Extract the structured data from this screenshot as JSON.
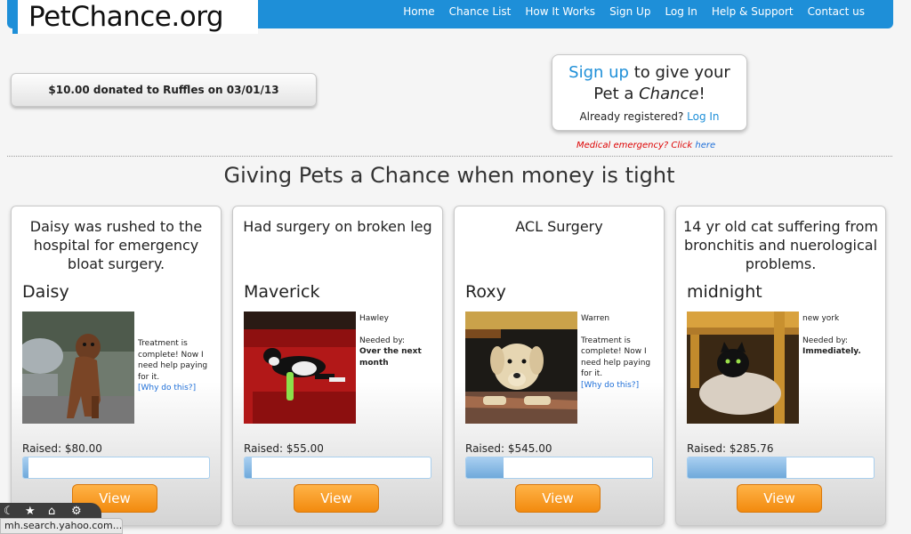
{
  "header": {
    "logo": "PetChance.org",
    "nav": [
      "Home",
      "Chance List",
      "How It Works",
      "Sign Up",
      "Log In",
      "Help & Support",
      "Contact us"
    ]
  },
  "donation": "$10.00 donated to Ruffles on 03/01/13",
  "signup": {
    "signup_link": "Sign up",
    "line1_rest": " to give your",
    "line2_pre": "Pet a ",
    "line2_em": "Chance",
    "line2_post": "!",
    "registered": "Already registered? ",
    "login_link": "Log In"
  },
  "emergency": {
    "text": "Medical emergency? Click ",
    "link": "here"
  },
  "tagline": "Giving Pets a Chance when money is tight",
  "cards": [
    {
      "title": "Daisy was rushed to the hospital for emergency bloat surgery.",
      "name": "Daisy",
      "location": "",
      "needed_label": "",
      "needed_value": "",
      "note": "Treatment is complete! Now I need help paying for it.",
      "why": "[Why do this?]",
      "raised": "Raised: $80.00",
      "progress": 0.03,
      "view": "View"
    },
    {
      "title": "Had surgery on broken leg",
      "name": "Maverick",
      "location": "Hawley",
      "needed_label": "Needed by:",
      "needed_value": "Over the next month",
      "note": "",
      "why": "",
      "raised": "Raised: $55.00",
      "progress": 0.04,
      "view": "View"
    },
    {
      "title": "ACL Surgery",
      "name": "Roxy",
      "location": "Warren",
      "needed_label": "",
      "needed_value": "",
      "note": "Treatment is complete! Now I need help paying for it.",
      "why": "[Why do this?]",
      "raised": "Raised: $545.00",
      "progress": 0.2,
      "view": "View"
    },
    {
      "title": "14 yr old cat suffering from bronchitis and nuerological problems.",
      "name": "midnight",
      "location": "new york",
      "needed_label": "Needed by:",
      "needed_value": "Immediately.",
      "note": "",
      "why": "",
      "raised": "Raised: $285.76",
      "progress": 0.53,
      "view": "View"
    }
  ],
  "status_url": "mh.search.yahoo.com..."
}
